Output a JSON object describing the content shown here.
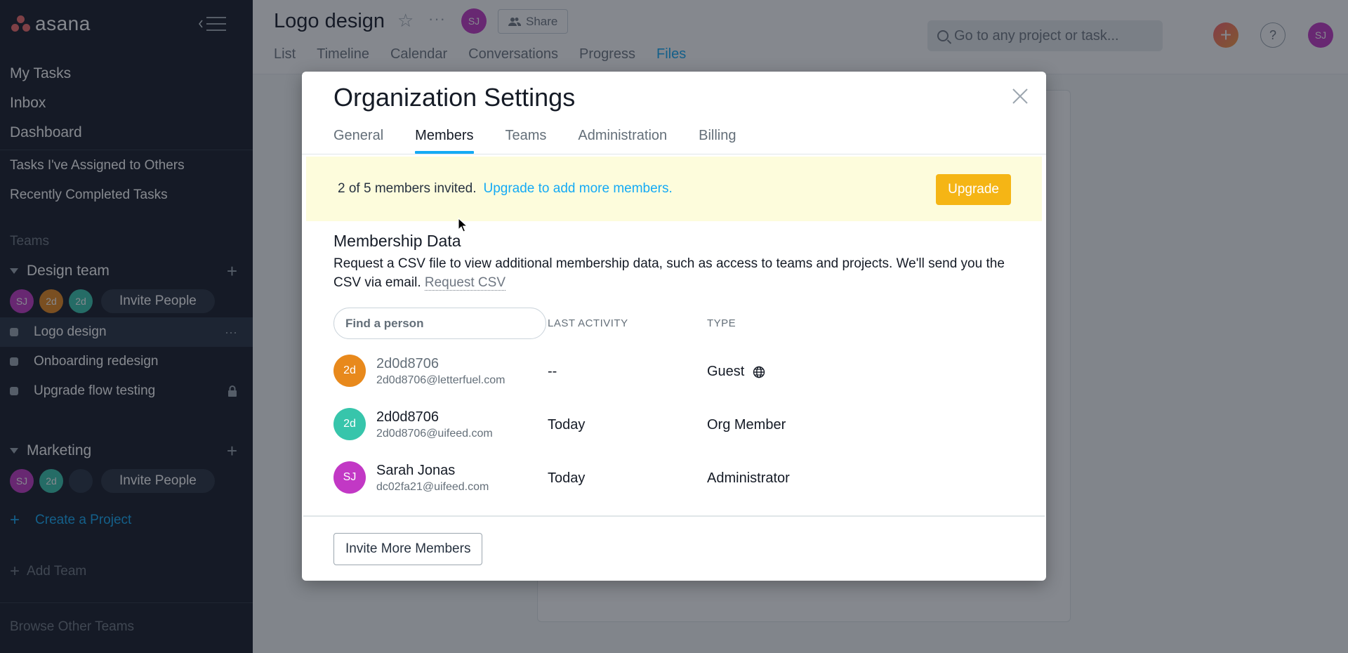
{
  "sidebar": {
    "logo_text": "asana",
    "nav": [
      "My Tasks",
      "Inbox",
      "Dashboard"
    ],
    "nav_secondary": [
      "Tasks I've Assigned to Others",
      "Recently Completed Tasks"
    ],
    "teams_label": "Teams",
    "teams": [
      {
        "name": "Design team",
        "members": [
          {
            "initials": "SJ",
            "color": "#c238c5"
          },
          {
            "initials": "2d",
            "color": "#e8891c"
          },
          {
            "initials": "2d",
            "color": "#37c5ab"
          }
        ],
        "invite_label": "Invite People",
        "projects": [
          {
            "name": "Logo design",
            "active": true
          },
          {
            "name": "Onboarding redesign",
            "active": false
          },
          {
            "name": "Upgrade flow testing",
            "active": false,
            "locked": true
          }
        ]
      },
      {
        "name": "Marketing",
        "members": [
          {
            "initials": "SJ",
            "color": "#c238c5"
          },
          {
            "initials": "2d",
            "color": "#37c5ab"
          },
          {
            "initials": "",
            "color": "#273142"
          }
        ],
        "invite_label": "Invite People"
      }
    ],
    "create_project": "Create a Project",
    "add_team": "Add Team",
    "browse_teams": "Browse Other Teams"
  },
  "header": {
    "project_title": "Logo design",
    "owner_initials": "SJ",
    "share_label": "Share",
    "tabs": [
      "List",
      "Timeline",
      "Calendar",
      "Conversations",
      "Progress",
      "Files"
    ],
    "active_tab": "Files",
    "search_placeholder": "Go to any project or task...",
    "user_initials": "SJ"
  },
  "modal": {
    "title": "Organization Settings",
    "tabs": [
      "General",
      "Members",
      "Teams",
      "Administration",
      "Billing"
    ],
    "active_tab": "Members",
    "banner": {
      "text": "2 of 5 members invited.",
      "link": "Upgrade to add more members.",
      "button": "Upgrade"
    },
    "section_title": "Membership Data",
    "section_desc": "Request a CSV file to view additional membership data, such as access to teams and projects. We'll send you the CSV via email.",
    "request_csv": "Request CSV",
    "find_placeholder": "Find a person",
    "columns": {
      "activity": "LAST ACTIVITY",
      "type": "TYPE"
    },
    "members": [
      {
        "initials": "2d",
        "color": "#e8891c",
        "name": "2d0d8706",
        "email": "2d0d8706@letterfuel.com",
        "activity": "--",
        "type": "Guest",
        "guest_icon": "globe-icon",
        "pending": true
      },
      {
        "initials": "2d",
        "color": "#37c5ab",
        "name": "2d0d8706",
        "email": "2d0d8706@uifeed.com",
        "activity": "Today",
        "type": "Org Member"
      },
      {
        "initials": "SJ",
        "color": "#c238c5",
        "name": "Sarah Jonas",
        "email": "dc02fa21@uifeed.com",
        "activity": "Today",
        "type": "Administrator"
      }
    ],
    "invite_more": "Invite More Members"
  },
  "colors": {
    "accent": "#14aaf5",
    "upgrade": "#f5b515",
    "banner_bg": "#fdfcdc",
    "sidebar_bg": "#151b26"
  }
}
